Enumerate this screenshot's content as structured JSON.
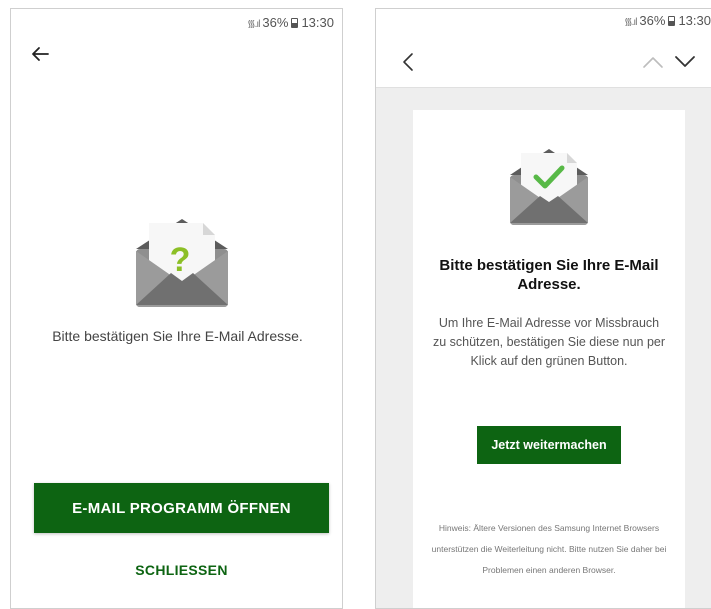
{
  "left_screen": {
    "status_bar": {
      "battery": "36%",
      "time": "13:30"
    },
    "message": "Bitte bestätigen Sie Ihre E-Mail Adresse.",
    "envelope_mark": "?",
    "primary_button": "E-MAIL PROGRAMM ÖFFNEN",
    "secondary_button": "SCHLIESSEN"
  },
  "right_screen": {
    "status_bar": {
      "battery": "36%",
      "time": "13:30"
    },
    "title": "Bitte bestätigen Sie Ihre E-Mail Adresse.",
    "body": "Um Ihre E-Mail Adresse vor Missbrauch zu schützen, bestätigen Sie diese nun per Klick auf den grünen Button.",
    "button": "Jetzt weitermachen",
    "hint": "Hinweis: Ältere Versionen des Samsung Internet Browsers unterstützen die Weiterleitung nicht. Bitte nutzen Sie daher bei Problemen einen anderen Browser."
  },
  "colors": {
    "brand_green": "#0d6412",
    "accent_green": "#8cbf26",
    "check_green": "#58b947",
    "envelope_gray": "#8f8f8f"
  },
  "icons": {
    "left_back": "arrow-left-icon",
    "right_back": "chevron-left-icon",
    "nav_up": "chevron-up-icon",
    "nav_down": "chevron-down-icon"
  }
}
